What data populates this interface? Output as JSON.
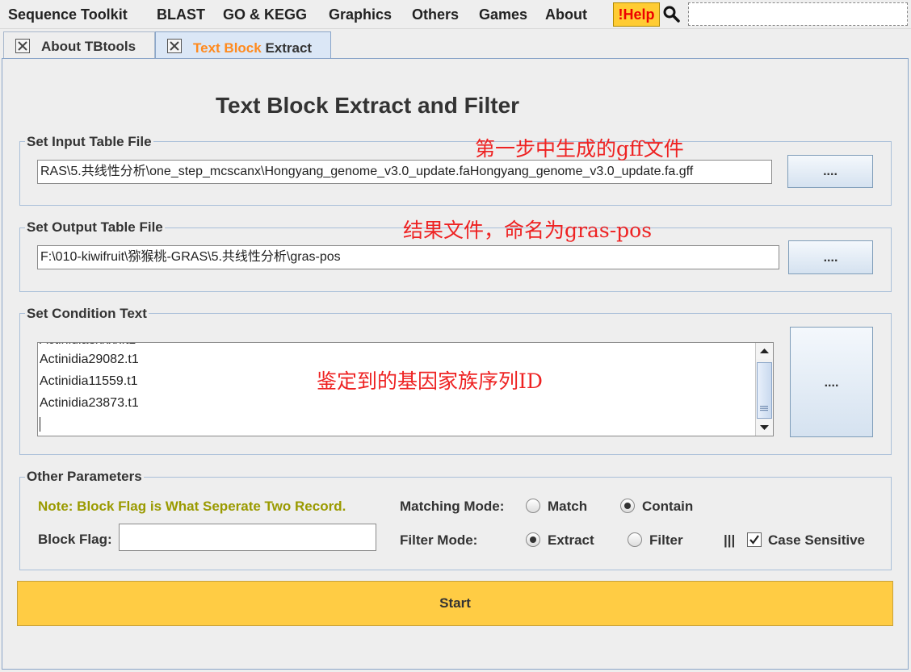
{
  "menubar": {
    "items": [
      "Sequence Toolkit",
      "BLAST",
      "GO & KEGG",
      "Graphics",
      "Others",
      "Games",
      "About"
    ],
    "help_label": "!Help"
  },
  "tabs": [
    {
      "label": "About TBtools",
      "active": false
    },
    {
      "label_highlight": "Text Block",
      "label_rest": " Extract",
      "active": true
    }
  ],
  "page_title": "Text Block Extract and Filter",
  "input_section": {
    "title": "Set Input Table File",
    "value": "RAS\\5.共线性分析\\one_step_mcscanx\\Hongyang_genome_v3.0_update.faHongyang_genome_v3.0_update.fa.gff",
    "browse_label": "....",
    "annotation": "第一步中生成的gff文件"
  },
  "output_section": {
    "title": "Set Output Table File",
    "value": "F:\\010-kiwifruit\\猕猴桃-GRAS\\5.共线性分析\\gras-pos",
    "browse_label": "....",
    "annotation": "结果文件，命名为gras-pos"
  },
  "condition_section": {
    "title": "Set Condition Text",
    "lines": [
      "Actinidia29082.t1",
      "Actinidia11559.t1",
      "Actinidia23873.t1"
    ],
    "browse_label": "....",
    "annotation": "鉴定到的基因家族序列ID"
  },
  "params_section": {
    "title": "Other Parameters",
    "note": "Note: Block Flag is What Seperate Two Record.",
    "block_flag_label": "Block Flag:",
    "block_flag_value": "",
    "matching_mode_label": "Matching Mode:",
    "matching_options": [
      "Match",
      "Contain"
    ],
    "matching_selected": "Contain",
    "filter_mode_label": "Filter Mode:",
    "filter_options": [
      "Extract",
      "Filter"
    ],
    "filter_selected": "Extract",
    "separator": "|||",
    "case_sensitive_label": "Case Sensitive",
    "case_sensitive_checked": true
  },
  "start_label": "Start",
  "colors": {
    "accent_yellow": "#ffcc44",
    "tab_highlight": "#ff8a1e",
    "annotation_red": "#ee2222",
    "note_olive": "#9a9a00"
  }
}
